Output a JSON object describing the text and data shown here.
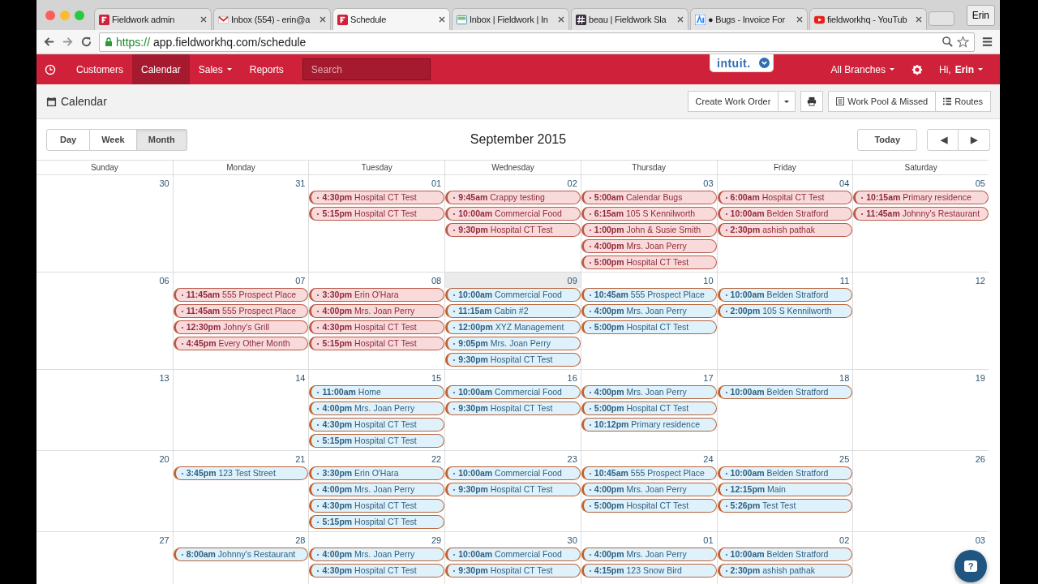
{
  "browser": {
    "tabs": [
      {
        "title": "Fieldwork admin",
        "kind": "fieldwork",
        "selected": false
      },
      {
        "title": "Inbox (554) - erin@a",
        "kind": "mail",
        "selected": false
      },
      {
        "title": "Schedule",
        "kind": "fieldwork",
        "selected": true
      },
      {
        "title": "Inbox | Fieldwork | In",
        "kind": "inbox",
        "selected": false
      },
      {
        "title": "beau | Fieldwork Sla",
        "kind": "hash",
        "selected": false
      },
      {
        "title": "● Bugs - Invoice For",
        "kind": "tracker",
        "selected": false
      },
      {
        "title": "fieldworkhq - YouTub",
        "kind": "video",
        "selected": false
      }
    ],
    "profile": "Erin",
    "url": {
      "scheme": "https://",
      "rest": "app.fieldworkhq.com/schedule"
    }
  },
  "nav": {
    "items": [
      {
        "label": "Customers",
        "selected": false,
        "dropdown": false
      },
      {
        "label": "Calendar",
        "selected": true,
        "dropdown": false
      },
      {
        "label": "Sales",
        "selected": false,
        "dropdown": true
      },
      {
        "label": "Reports",
        "selected": false,
        "dropdown": false
      }
    ],
    "search": {
      "placeholder": "Search"
    },
    "badge": "intuit.",
    "branches": "All Branches",
    "user": "Hi, **Erin**"
  },
  "toolbar": {
    "title": "Calendar",
    "create": "Create Work Order",
    "pool": "Work Pool & Missed",
    "routes": "Routes"
  },
  "controls": {
    "views": [
      {
        "label": "Day",
        "selected": false
      },
      {
        "label": "Week",
        "selected": false
      },
      {
        "label": "Month",
        "selected": true
      }
    ],
    "title": "September 2015",
    "today": "Today",
    "prev": "◀",
    "next": "▶"
  },
  "weekdays": [
    "Sunday",
    "Monday",
    "Tuesday",
    "Wednesday",
    "Thursday",
    "Friday",
    "Saturday"
  ],
  "weeks": [
    {
      "days": [
        {
          "number": "30",
          "today": false
        },
        {
          "number": "31",
          "today": false
        },
        {
          "number": "01",
          "today": false,
          "events": [
            {
              "time": "4:30pm",
              "title": "Hospital CT Test",
              "past": true
            },
            {
              "time": "5:15pm",
              "title": "Hospital CT Test",
              "past": true
            }
          ]
        },
        {
          "number": "02",
          "today": false,
          "events": [
            {
              "time": "9:45am",
              "title": "Crappy testing",
              "past": true
            },
            {
              "time": "10:00am",
              "title": "Commercial Food",
              "past": true
            },
            {
              "time": "9:30pm",
              "title": "Hospital CT Test",
              "past": true
            }
          ]
        },
        {
          "number": "03",
          "today": false,
          "events": [
            {
              "time": "5:00am",
              "title": "Calendar Bugs",
              "past": true
            },
            {
              "time": "6:15am",
              "title": "105 S Kennilworth",
              "past": true
            },
            {
              "time": "1:00pm",
              "title": "John & Susie Smith",
              "past": true
            },
            {
              "time": "4:00pm",
              "title": "Mrs. Joan Perry",
              "past": true
            },
            {
              "time": "5:00pm",
              "title": "Hospital CT Test",
              "past": true
            }
          ]
        },
        {
          "number": "04",
          "today": false,
          "events": [
            {
              "time": "6:00am",
              "title": "Hospital CT Test",
              "past": true
            },
            {
              "time": "10:00am",
              "title": "Belden Stratford",
              "past": true
            },
            {
              "time": "2:30pm",
              "title": "ashish pathak",
              "past": true
            }
          ]
        },
        {
          "number": "05",
          "today": false,
          "events": [
            {
              "time": "10:15am",
              "title": "Primary residence",
              "past": true
            },
            {
              "time": "11:45am",
              "title": "Johnny's Restaurant",
              "past": true
            }
          ]
        }
      ]
    },
    {
      "days": [
        {
          "number": "06",
          "today": false
        },
        {
          "number": "07",
          "today": false,
          "events": [
            {
              "time": "11:45am",
              "title": "555 Prospect Place",
              "past": true
            },
            {
              "time": "11:45am",
              "title": "555 Prospect Place",
              "past": true
            },
            {
              "time": "12:30pm",
              "title": "Johny's Grill",
              "past": true
            },
            {
              "time": "4:45pm",
              "title": "Every Other Month",
              "past": true
            }
          ]
        },
        {
          "number": "08",
          "today": false,
          "events": [
            {
              "time": "3:30pm",
              "title": "Erin O'Hara",
              "past": true
            },
            {
              "time": "4:00pm",
              "title": "Mrs. Joan Perry",
              "past": true
            },
            {
              "time": "4:30pm",
              "title": "Hospital CT Test",
              "past": true
            },
            {
              "time": "5:15pm",
              "title": "Hospital CT Test",
              "past": true
            }
          ]
        },
        {
          "number": "09",
          "today": true,
          "events": [
            {
              "time": "10:00am",
              "title": "Commercial Food",
              "past": false
            },
            {
              "time": "11:15am",
              "title": "Cabin #2",
              "past": false
            },
            {
              "time": "12:00pm",
              "title": "XYZ Management",
              "past": false
            },
            {
              "time": "9:05pm",
              "title": "Mrs. Joan Perry",
              "past": false
            },
            {
              "time": "9:30pm",
              "title": "Hospital CT Test",
              "past": false
            }
          ]
        },
        {
          "number": "10",
          "today": false,
          "events": [
            {
              "time": "10:45am",
              "title": "555 Prospect Place",
              "past": false
            },
            {
              "time": "4:00pm",
              "title": "Mrs. Joan Perry",
              "past": false
            },
            {
              "time": "5:00pm",
              "title": "Hospital CT Test",
              "past": false
            }
          ]
        },
        {
          "number": "11",
          "today": false,
          "events": [
            {
              "time": "10:00am",
              "title": "Belden Stratford",
              "past": false
            },
            {
              "time": "2:00pm",
              "title": "105 S Kennilworth",
              "past": false
            }
          ]
        },
        {
          "number": "12",
          "today": false
        }
      ]
    },
    {
      "days": [
        {
          "number": "13",
          "today": false
        },
        {
          "number": "14",
          "today": false
        },
        {
          "number": "15",
          "today": false,
          "events": [
            {
              "time": "11:00am",
              "title": "Home",
              "past": false
            },
            {
              "time": "4:00pm",
              "title": "Mrs. Joan Perry",
              "past": false
            },
            {
              "time": "4:30pm",
              "title": "Hospital CT Test",
              "past": false
            },
            {
              "time": "5:15pm",
              "title": "Hospital CT Test",
              "past": false
            }
          ]
        },
        {
          "number": "16",
          "today": false,
          "events": [
            {
              "time": "10:00am",
              "title": "Commercial Food",
              "past": false
            },
            {
              "time": "9:30pm",
              "title": "Hospital CT Test",
              "past": false
            }
          ]
        },
        {
          "number": "17",
          "today": false,
          "events": [
            {
              "time": "4:00pm",
              "title": "Mrs. Joan Perry",
              "past": false
            },
            {
              "time": "5:00pm",
              "title": "Hospital CT Test",
              "past": false
            },
            {
              "time": "10:12pm",
              "title": "Primary residence",
              "past": false
            }
          ]
        },
        {
          "number": "18",
          "today": false,
          "events": [
            {
              "time": "10:00am",
              "title": "Belden Stratford",
              "past": false
            }
          ]
        },
        {
          "number": "19",
          "today": false
        }
      ]
    },
    {
      "days": [
        {
          "number": "20",
          "today": false
        },
        {
          "number": "21",
          "today": false,
          "events": [
            {
              "time": "3:45pm",
              "title": "123 Test Street",
              "past": false
            }
          ]
        },
        {
          "number": "22",
          "today": false,
          "events": [
            {
              "time": "3:30pm",
              "title": "Erin O'Hara",
              "past": false
            },
            {
              "time": "4:00pm",
              "title": "Mrs. Joan Perry",
              "past": false
            },
            {
              "time": "4:30pm",
              "title": "Hospital CT Test",
              "past": false
            },
            {
              "time": "5:15pm",
              "title": "Hospital CT Test",
              "past": false
            }
          ]
        },
        {
          "number": "23",
          "today": false,
          "events": [
            {
              "time": "10:00am",
              "title": "Commercial Food",
              "past": false
            },
            {
              "time": "9:30pm",
              "title": "Hospital CT Test",
              "past": false
            }
          ]
        },
        {
          "number": "24",
          "today": false,
          "events": [
            {
              "time": "10:45am",
              "title": "555 Prospect Place",
              "past": false
            },
            {
              "time": "4:00pm",
              "title": "Mrs. Joan Perry",
              "past": false
            },
            {
              "time": "5:00pm",
              "title": "Hospital CT Test",
              "past": false
            }
          ]
        },
        {
          "number": "25",
          "today": false,
          "events": [
            {
              "time": "10:00am",
              "title": "Belden Stratford",
              "past": false
            },
            {
              "time": "12:15pm",
              "title": "Main",
              "past": false
            },
            {
              "time": "5:26pm",
              "title": "Test Test",
              "past": false
            }
          ]
        },
        {
          "number": "26",
          "today": false
        }
      ]
    },
    {
      "days": [
        {
          "number": "27",
          "today": false
        },
        {
          "number": "28",
          "today": false,
          "events": [
            {
              "time": "8:00am",
              "title": "Johnny's Restaurant",
              "past": false
            }
          ]
        },
        {
          "number": "29",
          "today": false,
          "events": [
            {
              "time": "4:00pm",
              "title": "Mrs. Joan Perry",
              "past": false
            },
            {
              "time": "4:30pm",
              "title": "Hospital CT Test",
              "past": false
            }
          ]
        },
        {
          "number": "30",
          "today": false,
          "events": [
            {
              "time": "10:00am",
              "title": "Commercial Food",
              "past": false
            },
            {
              "time": "9:30pm",
              "title": "Hospital CT Test",
              "past": false
            }
          ]
        },
        {
          "number": "01",
          "today": false,
          "events": [
            {
              "time": "4:00pm",
              "title": "Mrs. Joan Perry",
              "past": false
            },
            {
              "time": "4:15pm",
              "title": "123 Snow Bird",
              "past": false
            }
          ]
        },
        {
          "number": "02",
          "today": false,
          "events": [
            {
              "time": "10:00am",
              "title": "Belden Stratford",
              "past": false
            },
            {
              "time": "2:30pm",
              "title": "ashish pathak",
              "past": false
            }
          ]
        },
        {
          "number": "03",
          "today": false
        }
      ]
    }
  ],
  "help": "?"
}
